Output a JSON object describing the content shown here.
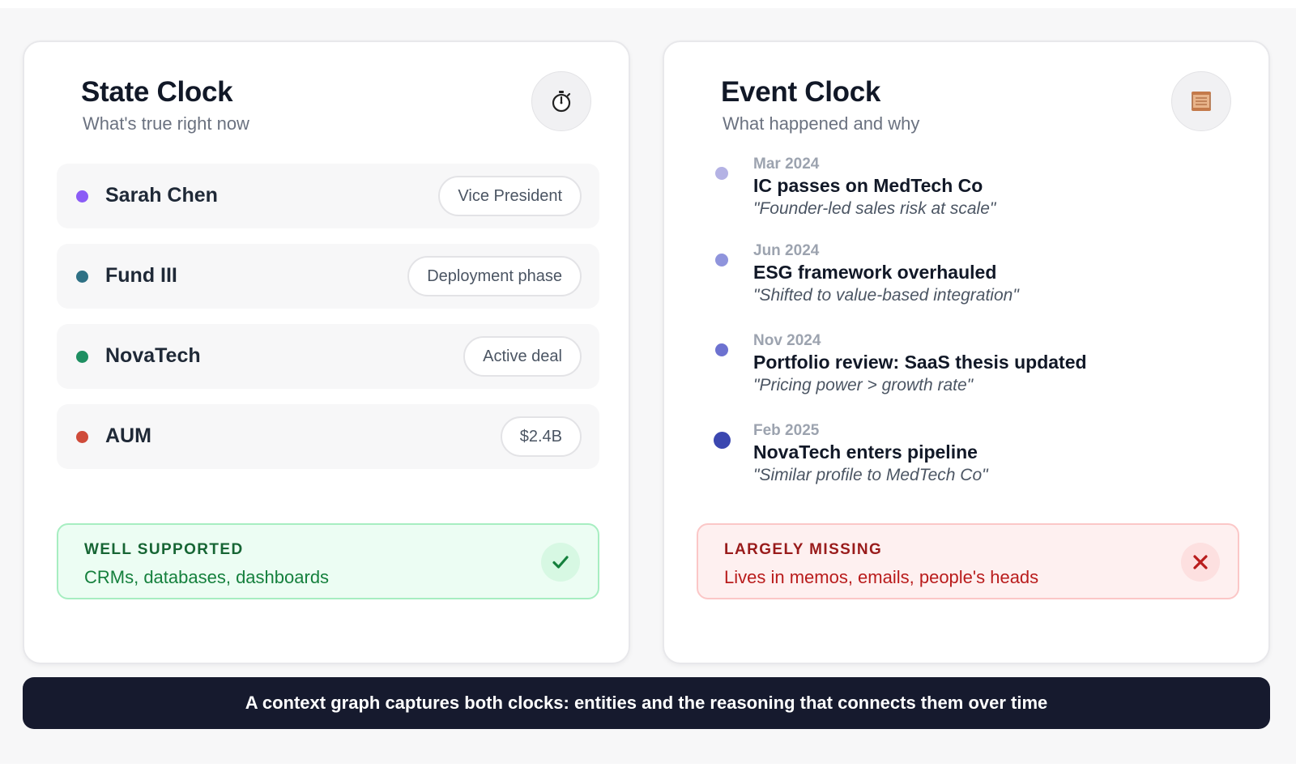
{
  "state_clock": {
    "title": "State Clock",
    "subtitle": "What's true right now",
    "icon": "stopwatch-icon",
    "rows": [
      {
        "name": "Sarah Chen",
        "value": "Vice President",
        "dot_color": "#8b5cf6"
      },
      {
        "name": "Fund III",
        "value": "Deployment phase",
        "dot_color": "#2f7185"
      },
      {
        "name": "NovaTech",
        "value": "Active deal",
        "dot_color": "#1f8f62"
      },
      {
        "name": "AUM",
        "value": "$2.4B",
        "dot_color": "#cf4b3a"
      }
    ],
    "status": {
      "label": "WELL SUPPORTED",
      "text": "CRMs, databases, dashboards",
      "icon": "checkmark-icon"
    }
  },
  "event_clock": {
    "title": "Event Clock",
    "subtitle": "What happened and why",
    "icon": "scroll-icon",
    "events": [
      {
        "date": "Mar 2024",
        "title": "IC passes on MedTech Co",
        "quote": "\"Founder-led sales risk at scale\"",
        "dot_color": "#b4b2e4"
      },
      {
        "date": "Jun 2024",
        "title": "ESG framework overhauled",
        "quote": "\"Shifted to value-based integration\"",
        "dot_color": "#8f94dc"
      },
      {
        "date": "Nov 2024",
        "title": "Portfolio review: SaaS thesis updated",
        "quote": "\"Pricing power > growth rate\"",
        "dot_color": "#6d72d0"
      },
      {
        "date": "Feb 2025",
        "title": "NovaTech enters pipeline",
        "quote": "\"Similar profile to MedTech Co\"",
        "dot_color": "#3b47b0"
      }
    ],
    "status": {
      "label": "LARGELY MISSING",
      "text": "Lives in memos, emails, people's heads",
      "icon": "close-x-icon"
    }
  },
  "banner": {
    "text": "A context graph captures both clocks: entities and the reasoning that connects them over time"
  }
}
